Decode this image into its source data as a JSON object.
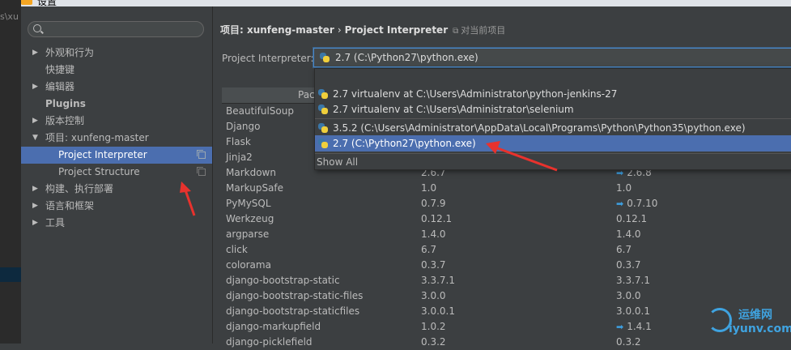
{
  "window": {
    "title": "设置",
    "side_strip_text": "s\\xu"
  },
  "search": {
    "placeholder": ""
  },
  "tree": [
    {
      "label": "外观和行为",
      "expandable": true,
      "bold": false
    },
    {
      "label": "快捷键",
      "expandable": false,
      "bold": false
    },
    {
      "label": "编辑器",
      "expandable": true,
      "bold": false
    },
    {
      "label": "Plugins",
      "expandable": false,
      "bold": true
    },
    {
      "label": "版本控制",
      "expandable": true,
      "bold": false
    },
    {
      "label": "项目: xunfeng-master",
      "expandable": true,
      "expanded": true,
      "bold": false
    },
    {
      "label": "Project Interpreter",
      "child": true,
      "selected": true
    },
    {
      "label": "Project Structure",
      "child": true,
      "selected": false
    },
    {
      "label": "构建、执行部署",
      "expandable": true,
      "bold": false
    },
    {
      "label": "语言和框架",
      "expandable": true,
      "bold": false
    },
    {
      "label": "工具",
      "expandable": true,
      "bold": false
    }
  ],
  "breadcrumb": {
    "project": "项目: xunfeng-master",
    "separator": "›",
    "page": "Project Interpreter",
    "note": "对当前项目"
  },
  "interpreter": {
    "label": "Project Interpreter:",
    "value": "2.7 (C:\\Python27\\python.exe)"
  },
  "table": {
    "header": "Pac",
    "rows": [
      {
        "name": "BeautifulSoup",
        "version": "",
        "latest": "",
        "upgrade": false
      },
      {
        "name": "Django",
        "version": "",
        "latest": "",
        "upgrade": false
      },
      {
        "name": "Flask",
        "version": "",
        "latest": "",
        "upgrade": false
      },
      {
        "name": "Jinja2",
        "version": "",
        "latest": "",
        "upgrade": false
      },
      {
        "name": "Markdown",
        "version": "2.6.7",
        "latest": "2.6.8",
        "upgrade": true
      },
      {
        "name": "MarkupSafe",
        "version": "1.0",
        "latest": "1.0",
        "upgrade": false
      },
      {
        "name": "PyMySQL",
        "version": "0.7.9",
        "latest": "0.7.10",
        "upgrade": true
      },
      {
        "name": "Werkzeug",
        "version": "0.12.1",
        "latest": "0.12.1",
        "upgrade": false
      },
      {
        "name": "argparse",
        "version": "1.4.0",
        "latest": "1.4.0",
        "upgrade": false
      },
      {
        "name": "click",
        "version": "6.7",
        "latest": "6.7",
        "upgrade": false
      },
      {
        "name": "colorama",
        "version": "0.3.7",
        "latest": "0.3.7",
        "upgrade": false
      },
      {
        "name": "django-bootstrap-static",
        "version": "3.3.7.1",
        "latest": "3.3.7.1",
        "upgrade": false
      },
      {
        "name": "django-bootstrap-static-files",
        "version": "3.0.0",
        "latest": "3.0.0",
        "upgrade": false
      },
      {
        "name": "django-bootstrap-staticfiles",
        "version": "3.0.0.1",
        "latest": "3.0.0.1",
        "upgrade": false
      },
      {
        "name": "django-markupfield",
        "version": "1.0.2",
        "latest": "1.4.1",
        "upgrade": true
      },
      {
        "name": "django-picklefield",
        "version": "0.3.2",
        "latest": "0.3.2",
        "upgrade": false
      }
    ]
  },
  "dropdown": {
    "items": [
      {
        "label": "2.7 virtualenv at C:\\Users\\Administrator\\python-jenkins-27",
        "selected": false
      },
      {
        "label": "2.7 virtualenv at C:\\Users\\Administrator\\selenium",
        "selected": false
      },
      {
        "label": "3.5.2 (C:\\Users\\Administrator\\AppData\\Local\\Programs\\Python\\Python35\\python.exe)",
        "selected": false
      },
      {
        "label": "2.7 (C:\\Python27\\python.exe)",
        "selected": true
      }
    ],
    "show_all": "Show All"
  },
  "watermark": {
    "name": "运维网",
    "url": "iyunv.com"
  },
  "colors": {
    "accent": "#4b6eaf",
    "annotation": "#e8322d",
    "upgrade_arrow": "#3d9fe0"
  },
  "icons": {
    "search": "search-icon",
    "python": "python-icon",
    "copy": "copy-icon",
    "expand": "chevron-right-icon",
    "collapse": "chevron-down-icon",
    "upgrade": "upgrade-arrow-icon"
  }
}
